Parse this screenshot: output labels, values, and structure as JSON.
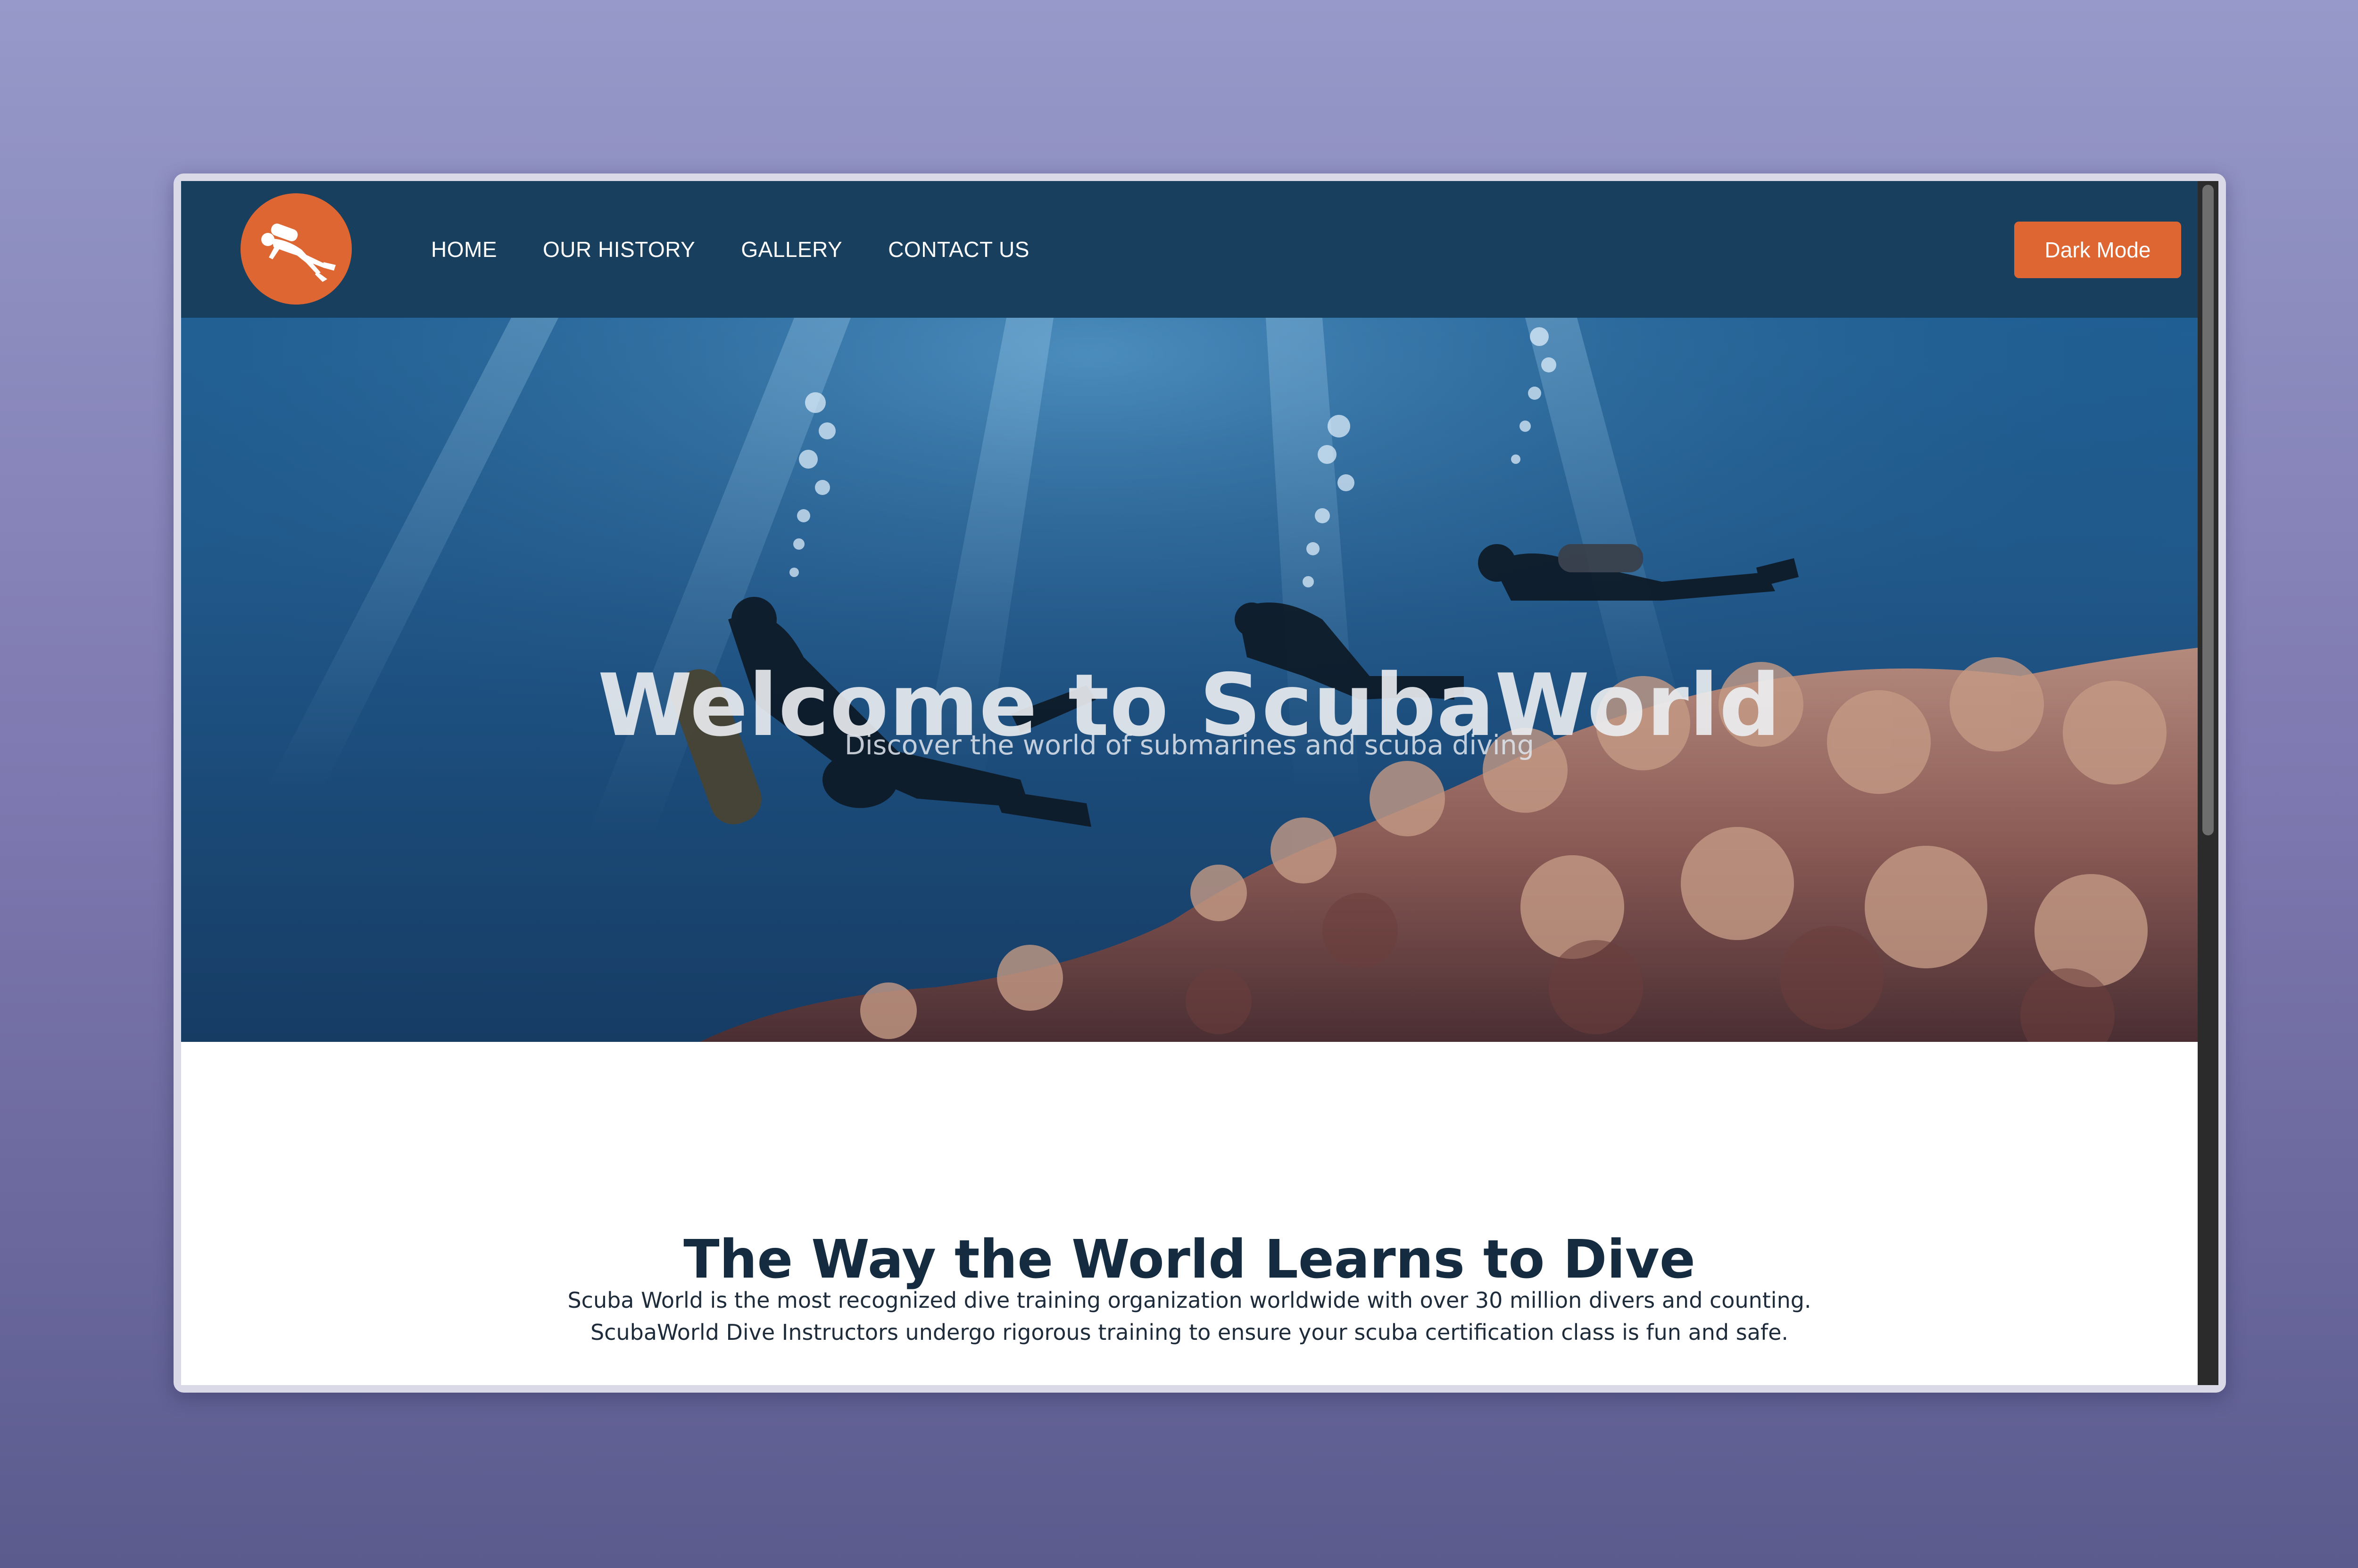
{
  "colors": {
    "navbar": "#183f5d",
    "accent": "#dd6633",
    "heading": "#152b40",
    "background_gradient_top": "#9699c9",
    "background_gradient_bottom": "#5b5b8e"
  },
  "navbar": {
    "logo_icon": "scuba-diver-icon",
    "links": [
      "HOME",
      "OUR HISTORY",
      "GALLERY",
      "CONTACT US"
    ],
    "dark_mode_label": "Dark Mode"
  },
  "hero": {
    "title": "Welcome to ScubaWorld",
    "subtitle": "Discover the world of submarines and scuba diving"
  },
  "intro": {
    "heading": "The Way the World Learns to Dive",
    "paragraph_lines": [
      "Scuba World is the most recognized dive training organization worldwide with over 30 million divers and counting.",
      "ScubaWorld Dive Instructors undergo rigorous training to ensure your scuba certification class is fun and safe."
    ]
  }
}
